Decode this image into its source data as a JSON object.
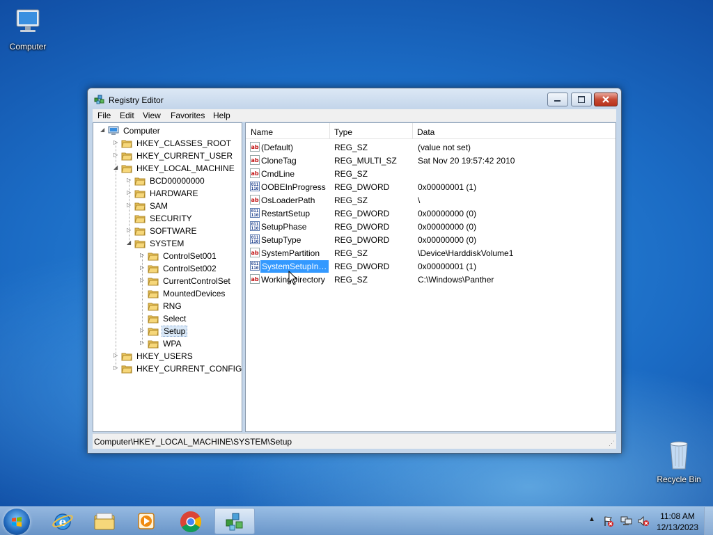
{
  "desktop": {
    "computer_label": "Computer",
    "recycle_label": "Recycle Bin"
  },
  "window": {
    "title": "Registry Editor",
    "menu": [
      "File",
      "Edit",
      "View",
      "Favorites",
      "Help"
    ],
    "status": "Computer\\HKEY_LOCAL_MACHINE\\SYSTEM\\Setup"
  },
  "tree": {
    "root": "Computer",
    "hkcr": "HKEY_CLASSES_ROOT",
    "hkcu": "HKEY_CURRENT_USER",
    "hklm": "HKEY_LOCAL_MACHINE",
    "bcd": "BCD00000000",
    "hardware": "HARDWARE",
    "sam": "SAM",
    "security": "SECURITY",
    "software": "SOFTWARE",
    "system": "SYSTEM",
    "cs001": "ControlSet001",
    "cs002": "ControlSet002",
    "ccs": "CurrentControlSet",
    "mounted": "MountedDevices",
    "rng": "RNG",
    "select": "Select",
    "setup": "Setup",
    "wpa": "WPA",
    "hku": "HKEY_USERS",
    "hkcc": "HKEY_CURRENT_CONFIG"
  },
  "list": {
    "headers": {
      "name": "Name",
      "type": "Type",
      "data": "Data"
    },
    "rows": [
      {
        "name": "(Default)",
        "type": "REG_SZ",
        "data": "(value not set)",
        "kind": "sz"
      },
      {
        "name": "CloneTag",
        "type": "REG_MULTI_SZ",
        "data": "Sat Nov 20 19:57:42 2010",
        "kind": "sz"
      },
      {
        "name": "CmdLine",
        "type": "REG_SZ",
        "data": "",
        "kind": "sz"
      },
      {
        "name": "OOBEInProgress",
        "type": "REG_DWORD",
        "data": "0x00000001 (1)",
        "kind": "dword"
      },
      {
        "name": "OsLoaderPath",
        "type": "REG_SZ",
        "data": "\\",
        "kind": "sz"
      },
      {
        "name": "RestartSetup",
        "type": "REG_DWORD",
        "data": "0x00000000 (0)",
        "kind": "dword"
      },
      {
        "name": "SetupPhase",
        "type": "REG_DWORD",
        "data": "0x00000000 (0)",
        "kind": "dword"
      },
      {
        "name": "SetupType",
        "type": "REG_DWORD",
        "data": "0x00000000 (0)",
        "kind": "dword"
      },
      {
        "name": "SystemPartition",
        "type": "REG_SZ",
        "data": "\\Device\\HarddiskVolume1",
        "kind": "sz"
      },
      {
        "name": "SystemSetupInP...",
        "type": "REG_DWORD",
        "data": "0x00000001 (1)",
        "kind": "dword"
      },
      {
        "name": "WorkingDirectory",
        "type": "REG_SZ",
        "data": "C:\\Windows\\Panther",
        "kind": "sz"
      }
    ]
  },
  "icons": {
    "sz": "ab",
    "dword": "011\n110"
  },
  "tray": {
    "time": "11:08 AM",
    "date": "12/13/2023"
  }
}
